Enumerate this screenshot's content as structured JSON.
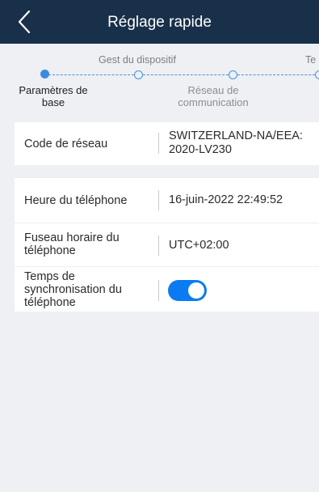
{
  "header": {
    "title": "Réglage rapide",
    "back_icon": "chevron-left-icon"
  },
  "stepper": {
    "steps": [
      {
        "top_label": "",
        "bottom_label": "Paramètres de base",
        "state": "current"
      },
      {
        "top_label": "Gest du dispositif",
        "bottom_label": "",
        "state": "upcoming"
      },
      {
        "top_label": "",
        "bottom_label": "Réseau de communication",
        "state": "upcoming"
      },
      {
        "top_label": "Te",
        "bottom_label": "",
        "state": "upcoming"
      }
    ]
  },
  "network_card": {
    "rows": [
      {
        "label": "Code de réseau",
        "value": "SWITZERLAND-NA/EEA:\n2020-LV230"
      }
    ]
  },
  "time_card": {
    "rows": [
      {
        "label": "Heure du téléphone",
        "value": "16-juin-2022 22:49:52"
      },
      {
        "label": "Fuseau horaire du téléphone",
        "value": "UTC+02:00"
      },
      {
        "label": "Temps de synchronisation du téléphone",
        "toggle_on": true
      }
    ]
  },
  "colors": {
    "header_bg": "#18304a",
    "accent": "#0a7bf2",
    "stepper_line": "#4a90e2",
    "page_bg": "#eef0f3"
  }
}
